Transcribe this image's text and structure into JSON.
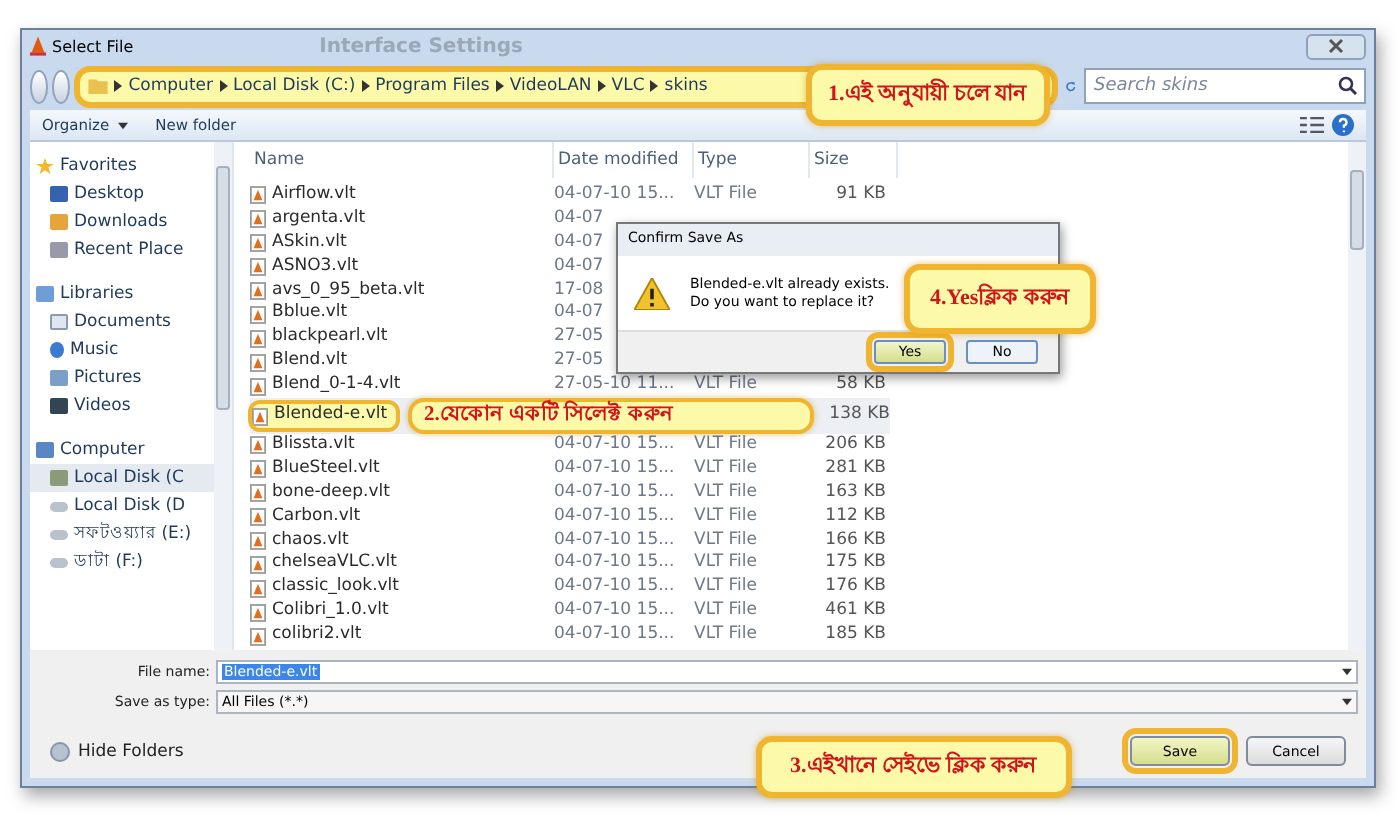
{
  "window": {
    "title": "Select File",
    "background_title": "Interface Settings"
  },
  "address_bar": {
    "path": [
      "Computer",
      "Local Disk (C:)",
      "Program Files",
      "VideoLAN",
      "VLC",
      "skins"
    ]
  },
  "search": {
    "placeholder": "Search skins"
  },
  "toolbar": {
    "organize": "Organize",
    "new_folder": "New folder"
  },
  "sidebar": {
    "groups": [
      {
        "label": "Favorites",
        "kind": "favorites",
        "children": [
          {
            "label": "Desktop",
            "kind": "desktop",
            "selected": false
          },
          {
            "label": "Downloads",
            "kind": "downloads",
            "selected": false
          },
          {
            "label": "Recent Place",
            "kind": "recent",
            "selected": false
          }
        ]
      },
      {
        "label": "Libraries",
        "kind": "libraries",
        "children": [
          {
            "label": "Documents",
            "kind": "documents",
            "selected": false
          },
          {
            "label": "Music",
            "kind": "music",
            "selected": false
          },
          {
            "label": "Pictures",
            "kind": "pictures",
            "selected": false
          },
          {
            "label": "Videos",
            "kind": "videos",
            "selected": false
          }
        ]
      },
      {
        "label": "Computer",
        "kind": "computer",
        "children": [
          {
            "label": "Local Disk (C",
            "kind": "system-drive",
            "selected": true
          },
          {
            "label": "Local Disk (D",
            "kind": "drive",
            "selected": false
          },
          {
            "label": "সফটওয়্যার (E:)",
            "kind": "drive",
            "selected": false
          },
          {
            "label": "ডাটা (F:)",
            "kind": "drive",
            "selected": false
          }
        ]
      }
    ]
  },
  "table": {
    "columns": [
      "Name",
      "Date modified",
      "Type",
      "Size"
    ],
    "rows": [
      {
        "name": "Airflow.vlt",
        "date": "04-07-10 15...",
        "type": "VLT File",
        "size": "91 KB",
        "selected": false
      },
      {
        "name": "argenta.vlt",
        "date": "04-07",
        "selected": false
      },
      {
        "name": "ASkin.vlt",
        "date": "04-07",
        "selected": false
      },
      {
        "name": "ASNO3.vlt",
        "date": "04-07",
        "selected": false
      },
      {
        "name": "avs_0_95_beta.vlt",
        "date": "17-08",
        "selected": false
      },
      {
        "name": "Bblue.vlt",
        "date": "04-07",
        "selected": false
      },
      {
        "name": "blackpearl.vlt",
        "date": "27-05",
        "selected": false
      },
      {
        "name": "Blend.vlt",
        "date": "27-05",
        "selected": false
      },
      {
        "name": "Blend_0-1-4.vlt",
        "date": "27-05-10 11...",
        "type": "VLT File",
        "size": "58 KB",
        "selected": false
      },
      {
        "name": "Blended-e.vlt",
        "size": "138 KB",
        "selected": true,
        "callout": "2.যেকোন একটি সিলেক্ট করুন"
      },
      {
        "name": "Blissta.vlt",
        "date": "04-07-10 15...",
        "type": "VLT File",
        "size": "206 KB",
        "selected": false
      },
      {
        "name": "BlueSteel.vlt",
        "date": "04-07-10 15...",
        "type": "VLT File",
        "size": "281 KB",
        "selected": false
      },
      {
        "name": "bone-deep.vlt",
        "date": "04-07-10 15...",
        "type": "VLT File",
        "size": "163 KB",
        "selected": false
      },
      {
        "name": "Carbon.vlt",
        "date": "04-07-10 15...",
        "type": "VLT File",
        "size": "112 KB",
        "selected": false
      },
      {
        "name": "chaos.vlt",
        "date": "04-07-10 15...",
        "type": "VLT File",
        "size": "166 KB",
        "selected": false
      },
      {
        "name": "chelseaVLC.vlt",
        "date": "04-07-10 15...",
        "type": "VLT File",
        "size": "175 KB",
        "selected": false
      },
      {
        "name": "classic_look.vlt",
        "date": "04-07-10 15...",
        "type": "VLT File",
        "size": "176 KB",
        "selected": false
      },
      {
        "name": "Colibri_1.0.vlt",
        "date": "04-07-10 15...",
        "type": "VLT File",
        "size": "461 KB",
        "selected": false
      },
      {
        "name": "colibri2.vlt",
        "date": "04-07-10 15...",
        "type": "VLT File",
        "size": "185 KB",
        "selected": false
      }
    ]
  },
  "file_name": {
    "label": "File name:",
    "value": "Blended-e.vlt"
  },
  "save_as_type": {
    "label": "Save as type:",
    "value": "All Files (*.*)"
  },
  "hide_folders": "Hide Folders",
  "buttons": [
    {
      "label": "Save",
      "highlighted": true
    },
    {
      "label": "Cancel",
      "highlighted": false
    }
  ],
  "confirm_dialog": {
    "title": "Confirm Save As",
    "lines": [
      "Blended-e.vlt already exists.",
      "Do you want to replace it?"
    ],
    "buttons": [
      {
        "label": "Yes",
        "highlighted": true
      },
      {
        "label": "No",
        "highlighted": false
      }
    ]
  },
  "callouts": [
    {
      "text": "1.এই অনুযায়ী চলে যান"
    },
    {
      "text": "4.Yesক্লিক করুন"
    },
    {
      "text": "3.এইখানে সেইভে ক্লিক করুন"
    }
  ]
}
